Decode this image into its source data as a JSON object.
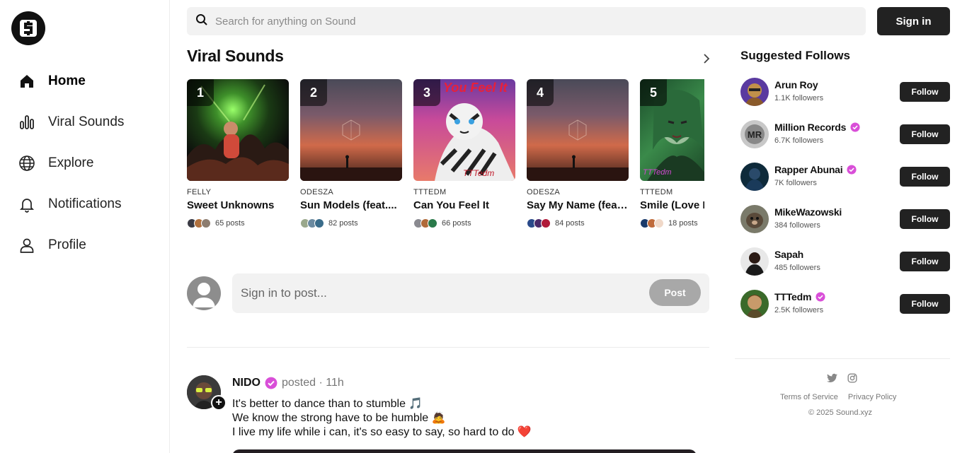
{
  "nav": {
    "items": [
      {
        "label": "Home",
        "icon": "home-icon"
      },
      {
        "label": "Viral Sounds",
        "icon": "bars-icon"
      },
      {
        "label": "Explore",
        "icon": "globe-icon"
      },
      {
        "label": "Notifications",
        "icon": "bell-icon"
      },
      {
        "label": "Profile",
        "icon": "user-icon"
      }
    ]
  },
  "search": {
    "placeholder": "Search for anything on Sound"
  },
  "header": {
    "signin_label": "Sign in"
  },
  "viral": {
    "title": "Viral Sounds",
    "tracks": [
      {
        "rank": "1",
        "artist": "FELLY",
        "title": "Sweet Unknowns",
        "posts": "65 posts"
      },
      {
        "rank": "2",
        "artist": "ODESZA",
        "title": "Sun Models (feat....",
        "posts": "82 posts"
      },
      {
        "rank": "3",
        "artist": "TTTEDM",
        "title": "Can You Feel It",
        "posts": "66 posts",
        "cover_text": "You Feel It",
        "cover_sub": "TTTedm"
      },
      {
        "rank": "4",
        "artist": "ODESZA",
        "title": "Say My Name (feat....",
        "posts": "84 posts"
      },
      {
        "rank": "5",
        "artist": "TTTEDM",
        "title": "Smile (Love Ri",
        "posts": "18 posts",
        "cover_sub": "TTTedm"
      }
    ]
  },
  "composer": {
    "placeholder": "Sign in to post...",
    "post_label": "Post"
  },
  "feed": {
    "name": "NIDO",
    "meta": "posted · 11h",
    "lines": [
      "It's better to dance than to stumble 🎵",
      "We know the strong have to be humble 🙇",
      "I live my life while i can, it's so easy to say, so hard to do ❤️"
    ]
  },
  "suggested": {
    "title": "Suggested Follows",
    "follow_label": "Follow",
    "items": [
      {
        "name": "Arun Roy",
        "followers": "1.1K followers",
        "verified": false
      },
      {
        "name": "Million Records",
        "followers": "6.7K followers",
        "verified": true
      },
      {
        "name": "Rapper Abunai",
        "followers": "7K followers",
        "verified": true
      },
      {
        "name": "MikeWazowski",
        "followers": "384 followers",
        "verified": false
      },
      {
        "name": "Sapah",
        "followers": "485 followers",
        "verified": false
      },
      {
        "name": "TTTedm",
        "followers": "2.5K followers",
        "verified": true
      }
    ]
  },
  "footer": {
    "terms": "Terms of Service",
    "privacy": "Privacy Policy",
    "copyright": "© 2025 Sound.xyz"
  },
  "colors": {
    "verified": "#d94fd8",
    "dark": "#222222"
  }
}
